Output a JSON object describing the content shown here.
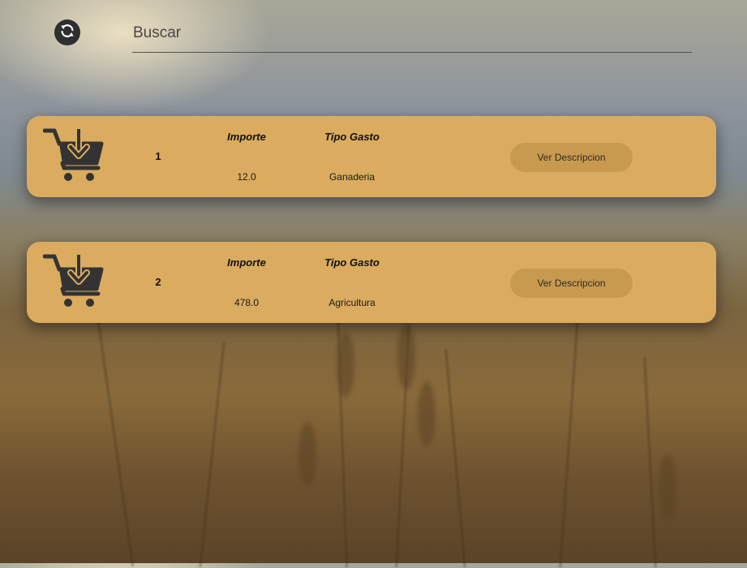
{
  "search": {
    "placeholder": "Buscar",
    "value": ""
  },
  "colors": {
    "card": "#dbac5f",
    "button": "#c89a50",
    "icon": "#333333"
  },
  "icons": {
    "refresh": "refresh-icon",
    "cart": "cart-download-icon"
  },
  "list": {
    "items": [
      {
        "id": "1",
        "importe_label": "Importe",
        "importe": "12.0",
        "tipo_label": "Tipo Gasto",
        "tipo": "Ganaderia",
        "button_label": "Ver Descripcion"
      },
      {
        "id": "2",
        "importe_label": "Importe",
        "importe": "478.0",
        "tipo_label": "Tipo Gasto",
        "tipo": "Agricultura",
        "button_label": "Ver Descripcion"
      }
    ]
  }
}
